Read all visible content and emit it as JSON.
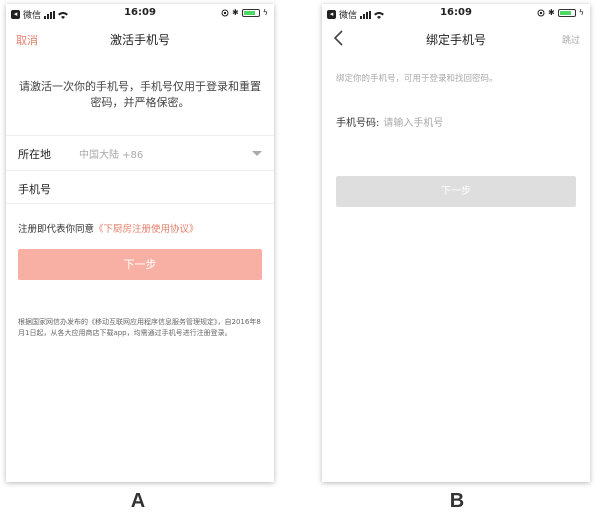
{
  "status": {
    "carrier": "微信",
    "time": "16:09"
  },
  "screen_a": {
    "label": "A",
    "nav": {
      "left": "取消",
      "title": "激活手机号"
    },
    "intro": "请激活一次你的手机号，手机号仅用于登录和重置密码，并严格保密。",
    "region": {
      "label": "所在地",
      "value": "中国大陆 +86"
    },
    "phone": {
      "label": "手机号"
    },
    "agree": {
      "prefix": "注册即代表你同意",
      "link": "《下厨房注册使用协议》"
    },
    "next": "下一步",
    "notice": "根据国家网信办发布的《移动互联网应用程序信息服务管理规定》，自2016年8月1日起，从各大应用商店下载app，均需通过手机号进行注册登录。",
    "colors": {
      "accent": "#e57f6b",
      "button": "#f9b0a4"
    }
  },
  "screen_b": {
    "label": "B",
    "nav": {
      "title": "绑定手机号",
      "right": "跳过"
    },
    "intro": "绑定你的手机号，可用于登录和找回密码。",
    "phone": {
      "label": "手机号码:",
      "placeholder": "请输入手机号"
    },
    "next": "下一步",
    "colors": {
      "button": "#dedede"
    }
  }
}
